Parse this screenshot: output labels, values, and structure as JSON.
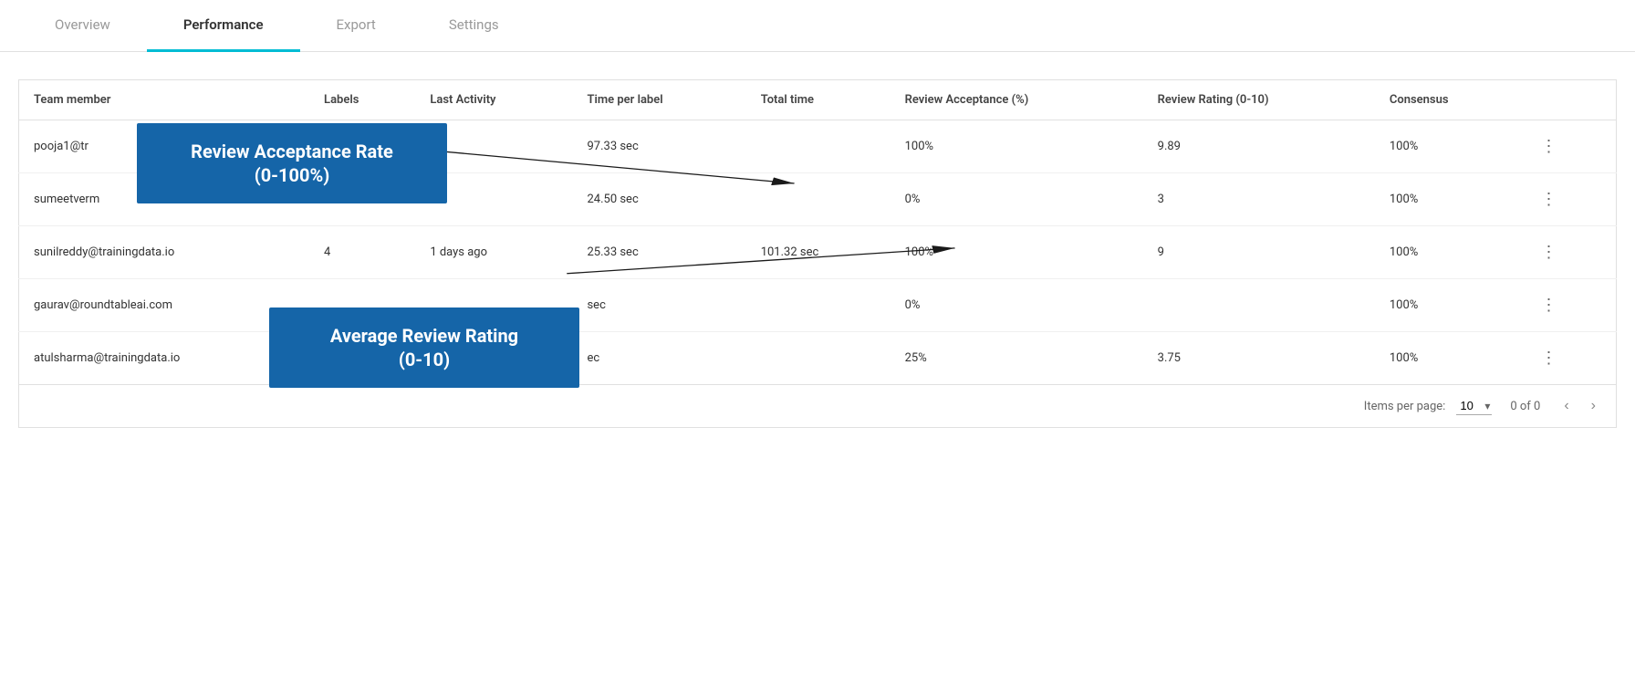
{
  "tabs": [
    {
      "id": "overview",
      "label": "Overview",
      "active": false
    },
    {
      "id": "performance",
      "label": "Performance",
      "active": true
    },
    {
      "id": "export",
      "label": "Export",
      "active": false
    },
    {
      "id": "settings",
      "label": "Settings",
      "active": false
    }
  ],
  "table": {
    "columns": [
      {
        "id": "team_member",
        "label": "Team member"
      },
      {
        "id": "labels",
        "label": "Labels"
      },
      {
        "id": "last_activity",
        "label": "Last Activity"
      },
      {
        "id": "time_per_label",
        "label": "Time per label"
      },
      {
        "id": "total_time",
        "label": "Total time"
      },
      {
        "id": "review_acceptance",
        "label": "Review Acceptance (%)"
      },
      {
        "id": "review_rating",
        "label": "Review Rating (0-10)"
      },
      {
        "id": "consensus",
        "label": "Consensus"
      },
      {
        "id": "actions",
        "label": ""
      }
    ],
    "rows": [
      {
        "team_member": "pooja1@tr",
        "labels": "",
        "last_activity": "",
        "time_per_label": "97.33 sec",
        "total_time": "",
        "review_acceptance": "100%",
        "review_rating": "9.89",
        "consensus": "100%",
        "actions": "⋮"
      },
      {
        "team_member": "sumeetverm",
        "labels": "",
        "last_activity": "",
        "time_per_label": "24.50 sec",
        "total_time": "",
        "review_acceptance": "0%",
        "review_rating": "3",
        "consensus": "100%",
        "actions": "⋮"
      },
      {
        "team_member": "sunilreddy@trainingdata.io",
        "labels": "4",
        "last_activity": "1 days ago",
        "time_per_label": "25.33 sec",
        "total_time": "101.32 sec",
        "review_acceptance": "100%",
        "review_rating": "9",
        "consensus": "100%",
        "actions": "⋮"
      },
      {
        "team_member": "gaurav@roundtableai.com",
        "labels": "",
        "last_activity": "",
        "time_per_label": "sec",
        "total_time": "",
        "review_acceptance": "0%",
        "review_rating": "",
        "consensus": "100%",
        "actions": "⋮"
      },
      {
        "team_member": "atulsharma@trainingdata.io",
        "labels": "",
        "last_activity": "",
        "time_per_label": "ec",
        "total_time": "",
        "review_acceptance": "25%",
        "review_rating": "3.75",
        "consensus": "100%",
        "actions": "⋮"
      }
    ]
  },
  "pagination": {
    "items_per_page_label": "Items per page:",
    "items_per_page_value": "10",
    "count_text": "0 of 0",
    "prev_icon": "‹",
    "next_icon": "›"
  },
  "annotations": {
    "box1_title": "Review Acceptance Rate",
    "box1_subtitle": "(0-100%)",
    "box2_title": "Average Review Rating",
    "box2_subtitle": "(0-10)"
  }
}
